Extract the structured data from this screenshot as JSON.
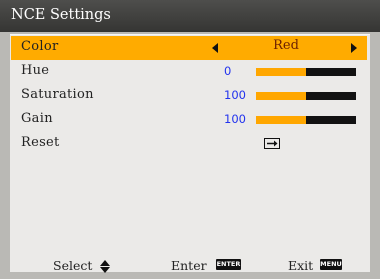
{
  "window": {
    "title": "NCE Settings"
  },
  "menu": {
    "color": {
      "label": "Color",
      "value": "Red"
    },
    "hue": {
      "label": "Hue",
      "value": "0",
      "level": 0.5
    },
    "saturation": {
      "label": "Saturation",
      "value": "100",
      "level": 0.5
    },
    "gain": {
      "label": "Gain",
      "value": "100",
      "level": 0.5
    },
    "reset": {
      "label": "Reset",
      "icon": "enter-arrow-icon"
    }
  },
  "footer": {
    "select_label": "Select",
    "enter_label": "Enter",
    "enter_key": "ENTER",
    "exit_label": "Exit",
    "exit_key": "MENU"
  },
  "colors": {
    "highlight": "#ffab00",
    "bar_fill": "#ffa700",
    "value_blue": "#2233ee",
    "selected_value": "#6a1f02"
  }
}
